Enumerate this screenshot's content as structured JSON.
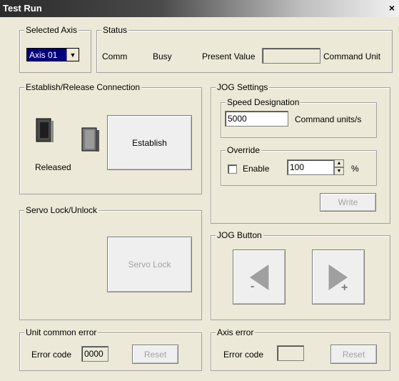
{
  "window": {
    "title": "Test Run",
    "close_label": "×"
  },
  "selected_axis": {
    "legend": "Selected Axis",
    "value": "Axis 01",
    "arrow": "▼"
  },
  "status": {
    "legend": "Status",
    "comm": "Comm",
    "busy": "Busy",
    "present_value_label": "Present Value",
    "present_value": "",
    "unit": "Command Unit"
  },
  "connection": {
    "legend": "Establish/Release Connection",
    "state_label": "Released",
    "establish_label": "Establish"
  },
  "servo": {
    "legend": "Servo Lock/Unlock",
    "servo_lock_label": "Servo Lock"
  },
  "jog_settings": {
    "legend": "JOG Settings",
    "speed": {
      "legend": "Speed Designation",
      "value": "5000",
      "unit": "Command units/s"
    },
    "override": {
      "legend": "Override",
      "enable_label": "Enable",
      "enabled": false,
      "value": "100",
      "unit": "%"
    },
    "write_label": "Write"
  },
  "jog_button": {
    "legend": "JOG Button",
    "minus_label": "-",
    "plus_label": "+"
  },
  "unit_error": {
    "legend": "Unit common error",
    "code_label": "Error code",
    "code_value": "0000",
    "reset_label": "Reset"
  },
  "axis_error": {
    "legend": "Axis error",
    "code_label": "Error code",
    "code_value": "",
    "reset_label": "Reset"
  }
}
